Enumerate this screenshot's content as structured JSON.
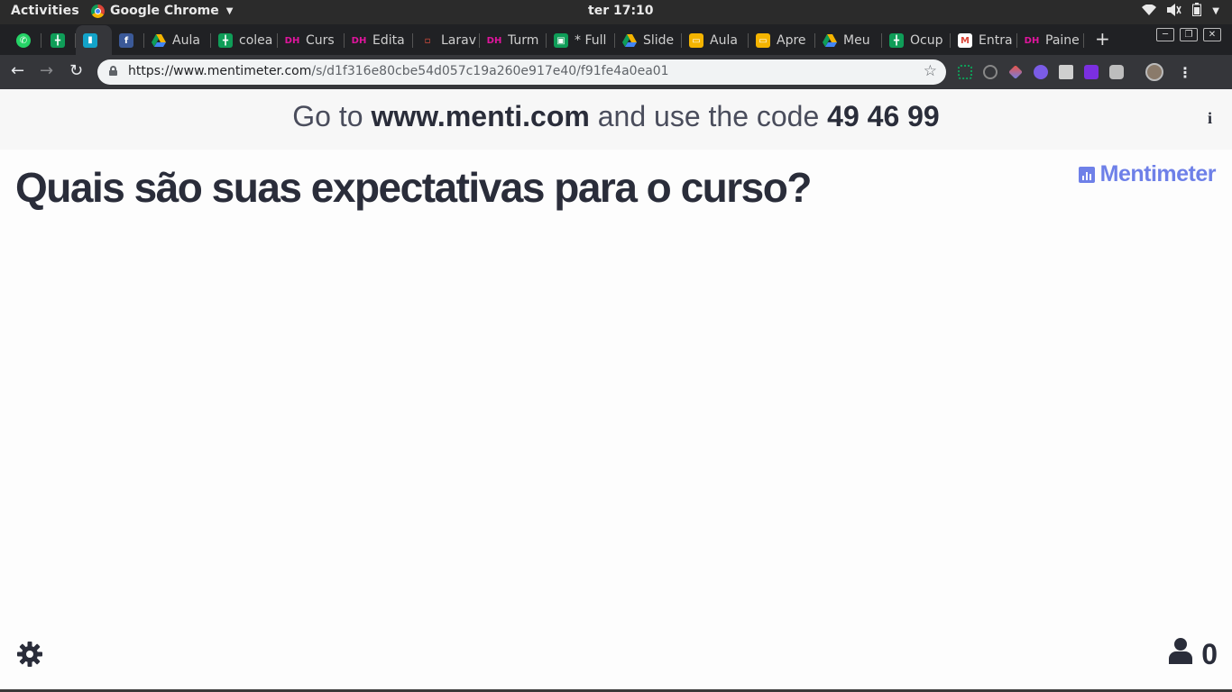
{
  "os_bar": {
    "activities": "Activities",
    "app_name": "Google Chrome",
    "clock": "ter 17:10"
  },
  "tabs": [
    {
      "label": "",
      "icon": "whatsapp-icon",
      "color": "#25d366"
    },
    {
      "label": "",
      "icon": "google-sheets-icon",
      "color": "#0f9d58"
    },
    {
      "label": "",
      "icon": "mentimeter-icon",
      "color": "#13a3c9",
      "active": true
    },
    {
      "label": "",
      "icon": "facebook-icon",
      "color": "#3b5998"
    },
    {
      "label": "Aula",
      "icon": "google-drive-icon",
      "color": "#f4b400"
    },
    {
      "label": "colea",
      "icon": "google-sheets-icon",
      "color": "#0f9d58"
    },
    {
      "label": "Curs",
      "icon": "dh-icon",
      "color": "#e0159d"
    },
    {
      "label": "Edita",
      "icon": "dh-icon",
      "color": "#e0159d"
    },
    {
      "label": "Larav",
      "icon": "laravel-icon",
      "color": "#f05340"
    },
    {
      "label": "Turm",
      "icon": "dh-icon",
      "color": "#e0159d"
    },
    {
      "label": "* Full",
      "icon": "trello-icon",
      "color": "#0f9d58"
    },
    {
      "label": "Slide",
      "icon": "google-drive-icon",
      "color": "#f4b400"
    },
    {
      "label": "Aula",
      "icon": "google-slides-icon",
      "color": "#f4b400"
    },
    {
      "label": "Apre",
      "icon": "google-slides-icon",
      "color": "#f4b400"
    },
    {
      "label": "Meu",
      "icon": "google-drive-icon",
      "color": "#f4b400"
    },
    {
      "label": "Ocup",
      "icon": "google-sheets-icon",
      "color": "#0f9d58"
    },
    {
      "label": "Entra",
      "icon": "gmail-icon",
      "color": "#db4437"
    },
    {
      "label": "Paine",
      "icon": "dh-icon",
      "color": "#e0159d"
    }
  ],
  "address_bar": {
    "url_host": "https://www.mentimeter.com",
    "url_path": "/s/d1f316e80cbe54d057c19a260e917e40/f91fe4a0ea01"
  },
  "join_bar": {
    "prefix": "Go to ",
    "site": "www.menti.com",
    "middle": " and use the code ",
    "code": "49 46 99"
  },
  "question": "Quais são suas expectativas para o curso?",
  "brand": "Mentimeter",
  "participant_count": "0",
  "colors": {
    "brand": "#6e80e8",
    "text_dark": "#2a2d3a"
  }
}
